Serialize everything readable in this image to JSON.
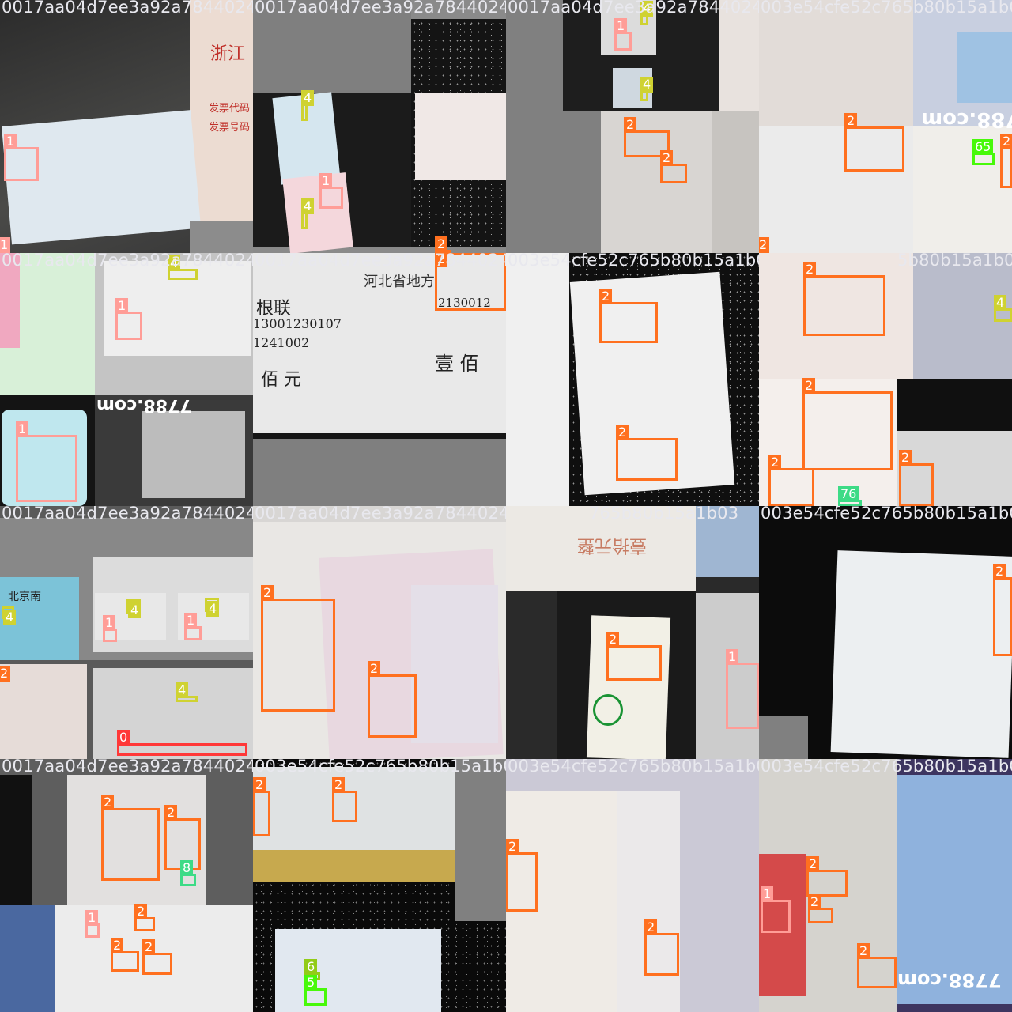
{
  "tiles": [
    {
      "label": "0017aa04d7ee3a92a784402442",
      "boxes": [
        {
          "cls": "1"
        },
        {
          "cls": "1"
        }
      ]
    },
    {
      "label": "0017aa04d7ee3a92a784402442",
      "boxes": [
        {
          "cls": "4"
        },
        {
          "cls": "1"
        },
        {
          "cls": "4"
        },
        {
          "cls": "2"
        }
      ]
    },
    {
      "label": "0017aa04d7ee3a92a784402442",
      "boxes": [
        {
          "cls": "1"
        },
        {
          "cls": "4"
        },
        {
          "cls": "4"
        },
        {
          "cls": "2"
        },
        {
          "cls": "2"
        }
      ]
    },
    {
      "label": "003e54cfe52c765b80b15a1b03",
      "boxes": [
        {
          "cls": "2"
        },
        {
          "cls": "65"
        },
        {
          "cls": "2"
        },
        {
          "cls": "2"
        }
      ]
    },
    {
      "label": "0017aa04d7ee3a92a784402442",
      "boxes": [
        {
          "cls": "4"
        },
        {
          "cls": "1"
        },
        {
          "cls": "1"
        }
      ]
    },
    {
      "label": "0017aa04d7ee3a92a784402442",
      "boxes": [
        {
          "cls": "2"
        }
      ]
    },
    {
      "label": "003e54cfe52c765b80b15a1b03",
      "boxes": [
        {
          "cls": "2"
        },
        {
          "cls": "2"
        }
      ]
    },
    {
      "label": "5b80b15a1b03",
      "boxes": [
        {
          "cls": "2"
        },
        {
          "cls": "4"
        },
        {
          "cls": "2"
        },
        {
          "cls": "2"
        },
        {
          "cls": "2"
        },
        {
          "cls": "76"
        }
      ]
    },
    {
      "label": "0017aa04d7ee3a92a784402442",
      "boxes": [
        {
          "cls": "4"
        },
        {
          "cls": "4"
        },
        {
          "cls": "4"
        },
        {
          "cls": "1"
        },
        {
          "cls": "1"
        },
        {
          "cls": "2"
        },
        {
          "cls": "4"
        },
        {
          "cls": "0"
        }
      ]
    },
    {
      "label": "0017aa04d7ee3a92a784402442",
      "boxes": [
        {
          "cls": "2"
        },
        {
          "cls": "2"
        }
      ]
    },
    {
      "label": "765b80b15a1b03",
      "boxes": [
        {
          "cls": "2"
        },
        {
          "cls": "1"
        },
        {
          "cls": "3"
        }
      ]
    },
    {
      "label": "003e54cfe52c765b80b15a1b03",
      "boxes": [
        {
          "cls": "2"
        }
      ]
    },
    {
      "label": "0017aa04d7ee3a92a784402442",
      "boxes": [
        {
          "cls": "2"
        },
        {
          "cls": "2"
        },
        {
          "cls": "8"
        },
        {
          "cls": "1"
        },
        {
          "cls": "2"
        },
        {
          "cls": "2"
        },
        {
          "cls": "2"
        }
      ]
    },
    {
      "label": "003e54cfe52c765b80b15a1b03",
      "boxes": [
        {
          "cls": "2"
        },
        {
          "cls": "2"
        },
        {
          "cls": "6"
        },
        {
          "cls": "5"
        }
      ]
    },
    {
      "label": "003e54cfe52c765b80b15a1b03",
      "boxes": [
        {
          "cls": "2"
        },
        {
          "cls": "2"
        }
      ]
    },
    {
      "label": "003e54cfe52c765b80b15a1b03",
      "boxes": [
        {
          "cls": "2"
        },
        {
          "cls": "1"
        },
        {
          "cls": "2"
        },
        {
          "cls": "2"
        }
      ]
    }
  ],
  "scene_text": {
    "zhejiang": "浙江",
    "invoice_code": "发票代码",
    "invoice_number": "发票号码",
    "hebei": "河北省地方",
    "stub": "根联",
    "hundred": "佰 元",
    "one_hundred": "壹 佰",
    "num_a": "13001230107",
    "num_b": "1241002",
    "num_c": "2130012",
    "watermark": "7788.com",
    "beijing_south": "北京南",
    "ticket_price": "壹拾元整"
  },
  "colors": {
    "class_0": "#ff3838",
    "class_1": "#ff9d97",
    "class_2": "#ff701f",
    "class_3": "#1a9334",
    "class_4": "#cfd231",
    "class_5": "#48f90a",
    "class_6": "#92cc17",
    "class_7": "#3ddb86",
    "class_8": "#1a9334"
  }
}
